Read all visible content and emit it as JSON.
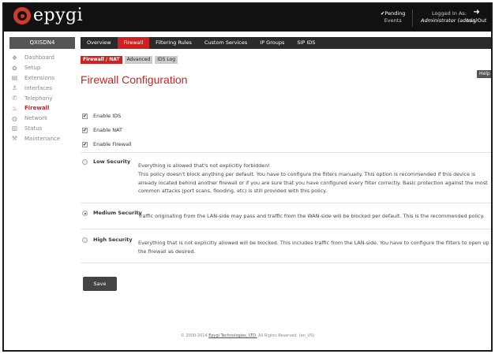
{
  "app": {
    "logo": "epygi"
  },
  "topbar": {
    "pending_label": "Pending",
    "pending_sub": "Events",
    "logged_label": "Logged In As:",
    "logged_user": "Administrator (admin)",
    "logout_label": "Log Out"
  },
  "sidebar": {
    "device_name": "QXISDN4",
    "items": [
      {
        "label": "Dashboard",
        "icon": "dashboard-icon"
      },
      {
        "label": "Setup",
        "icon": "gear-icon"
      },
      {
        "label": "Extensions",
        "icon": "extensions-icon"
      },
      {
        "label": "Interfaces",
        "icon": "interfaces-icon"
      },
      {
        "label": "Telephony",
        "icon": "phone-icon"
      },
      {
        "label": "Firewall",
        "icon": "flame-icon"
      },
      {
        "label": "Network",
        "icon": "globe-icon"
      },
      {
        "label": "Status",
        "icon": "chart-icon"
      },
      {
        "label": "Maintenance",
        "icon": "wrench-icon"
      }
    ],
    "active_item": "Firewall"
  },
  "tabs": [
    "Overview",
    "Firewall",
    "Filtering Rules",
    "Custom Services",
    "IP Groups",
    "SIP IDS"
  ],
  "active_tab": "Firewall",
  "subtabs": [
    "Firewall / NAT",
    "Advanced",
    "IDS Log"
  ],
  "active_subtab": "Firewall / NAT",
  "help_label": "Help",
  "page_title": "Firewall Configuration",
  "checkboxes": [
    {
      "label": "Enable IDS",
      "checked": true
    },
    {
      "label": "Enable NAT",
      "checked": true
    },
    {
      "label": "Enable Firewall",
      "checked": true
    }
  ],
  "security": {
    "selected": "Medium Security",
    "options": [
      {
        "label": "Low Security",
        "lines": [
          "Everything is allowed that's not explicitly forbidden!",
          "This policy doesn't block anything per default. You have to configure the filters manually. This option is recommended if this device is already located behind another firewall or if you are sure that you have configured every filter correctly. Basic protection against the most common attacks (port scans, flooding, etc) is still provided with this policy."
        ]
      },
      {
        "label": "Medium Security",
        "lines": [
          "Traffic originating from the LAN-side may pass and traffic from the WAN-side will be blocked per default. This is the recommended policy."
        ]
      },
      {
        "label": "High Security",
        "lines": [
          "Everything that is not explicitly allowed will be blocked. This includes traffic from the LAN-side. You have to configure the filters to open up the firewall as desired."
        ]
      }
    ]
  },
  "save_label": "Save",
  "footer": {
    "prefix": "© 2000-2014 ",
    "link": "Epygi Technologies, LTD.",
    "suffix": " All Rights Reserved. (en_US)"
  },
  "colors": {
    "accent": "#cc2222",
    "topbar": "#111111",
    "tabbar": "#2b2b2b"
  }
}
